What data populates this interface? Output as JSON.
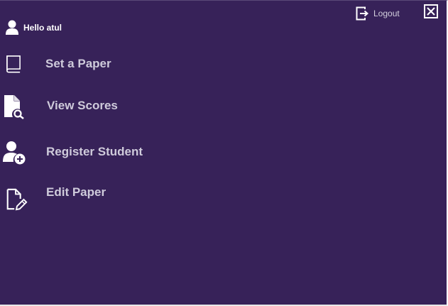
{
  "header": {
    "greeting": "Hello atul",
    "logout_label": "Logout",
    "user_icon": "user-icon",
    "logout_icon": "logout-icon",
    "close_icon": "close-icon"
  },
  "menu": {
    "items": [
      {
        "label": "Set a Paper",
        "icon": "book-icon"
      },
      {
        "label": "View Scores",
        "icon": "document-search-icon"
      },
      {
        "label": "Register Student",
        "icon": "add-user-icon"
      },
      {
        "label": "Edit Paper",
        "icon": "edit-document-icon"
      }
    ]
  },
  "colors": {
    "background": "#372259",
    "label": "#cfcbdb",
    "icon": "#ffffff"
  }
}
